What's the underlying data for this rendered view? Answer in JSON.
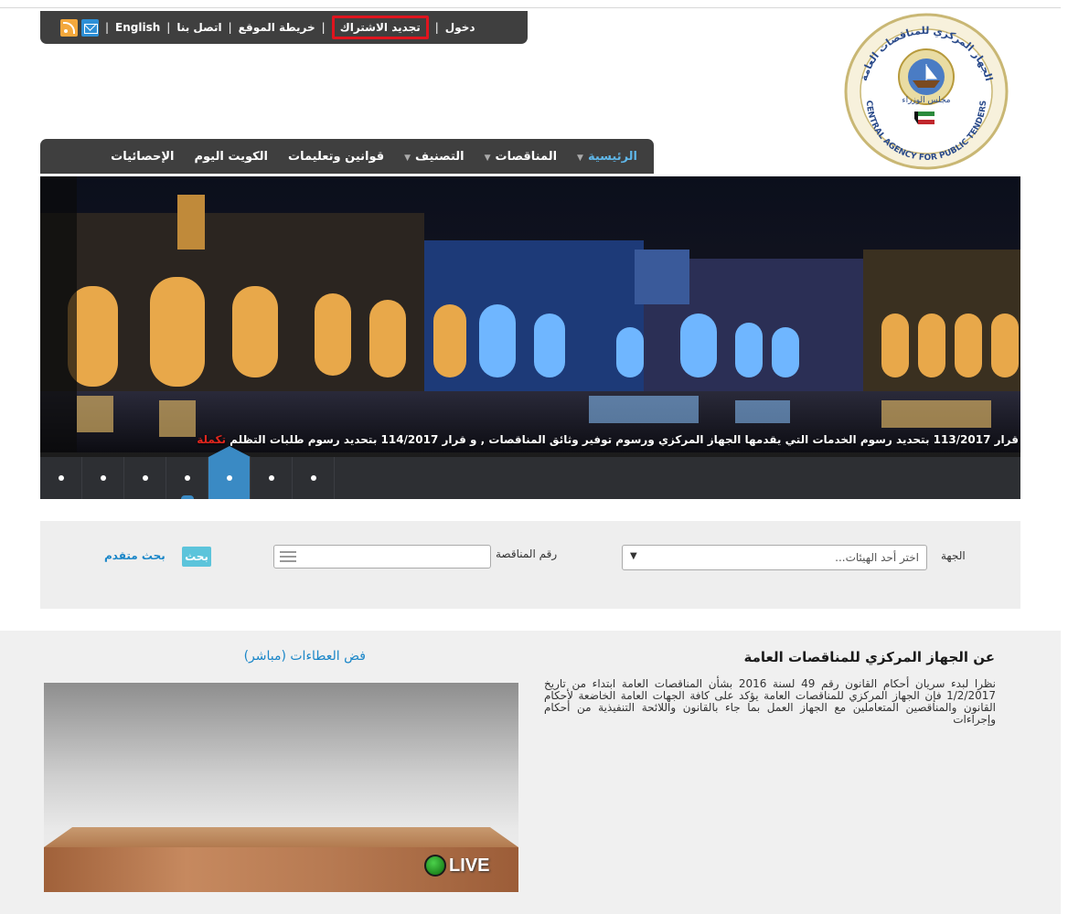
{
  "utility_bar": {
    "login": "دخول",
    "renew_subscription": "تجديد الاشتراك",
    "sitemap": "خريطة الموقع",
    "contact_us": "اتصل بنا",
    "english": "English",
    "icons": [
      "mail-icon",
      "rss-icon"
    ]
  },
  "logo": {
    "top_text_ar": "الجهاز المركزي للمناقصات العامة",
    "bottom_text_en": "CENTRAL AGENCY FOR PUBLIC TENDERS",
    "inner_text_ar": "مجلس الوزراء"
  },
  "main_nav": {
    "items": [
      {
        "label": "الرئيسية",
        "active": true,
        "has_dropdown": true
      },
      {
        "label": "المناقصات",
        "active": false,
        "has_dropdown": true
      },
      {
        "label": "التصنيف",
        "active": false,
        "has_dropdown": true
      },
      {
        "label": "قوانين وتعليمات",
        "active": false,
        "has_dropdown": false
      },
      {
        "label": "الكويت اليوم",
        "active": false,
        "has_dropdown": false
      },
      {
        "label": "الإحصائيات",
        "active": false,
        "has_dropdown": false
      }
    ]
  },
  "slider": {
    "caption": "قرار 113/2017 بتحديد رسوم الخدمات التي يقدمها الجهاز المركزي ورسوم توفير وثائق المناقصات , و قرار 114/2017 بتحديد رسوم طلبات التظلم",
    "more": "تكملة",
    "dot_count": 7,
    "active_dot": 5
  },
  "search": {
    "entity_label": "الجهة",
    "entity_placeholder": "اختر أحد الهيئات...",
    "tender_number_label": "رقم المناقصة",
    "search_button": "بحث",
    "advanced_search": "بحث متقدم"
  },
  "about": {
    "title": "عن الجهاز المركزي للمناقصات العامة",
    "text": "نظرا لبدء سريان أحكام القانون رقم 49 لسنة 2016 بشأن المناقصات العامة ابتداء من تاريخ 1/2/2017 فإن الجهاز المركزي للمناقصات العامة يؤكد على كافة الجهات العامة الخاضعة لأحكام القانون والمناقصين المتعاملين مع الجهاز العمل بما جاء بالقانون واللائحة التنفيذية من أحكام وإجراءات"
  },
  "live": {
    "title": "فض العطاءات (مباشر)",
    "badge": "LIVE"
  },
  "colors": {
    "bar_bg": "#3f3f3f",
    "active_nav": "#5fb6e8",
    "highlight_border": "#e0141e",
    "link_blue": "#1a86c8",
    "button_cyan": "#5cc4db"
  }
}
